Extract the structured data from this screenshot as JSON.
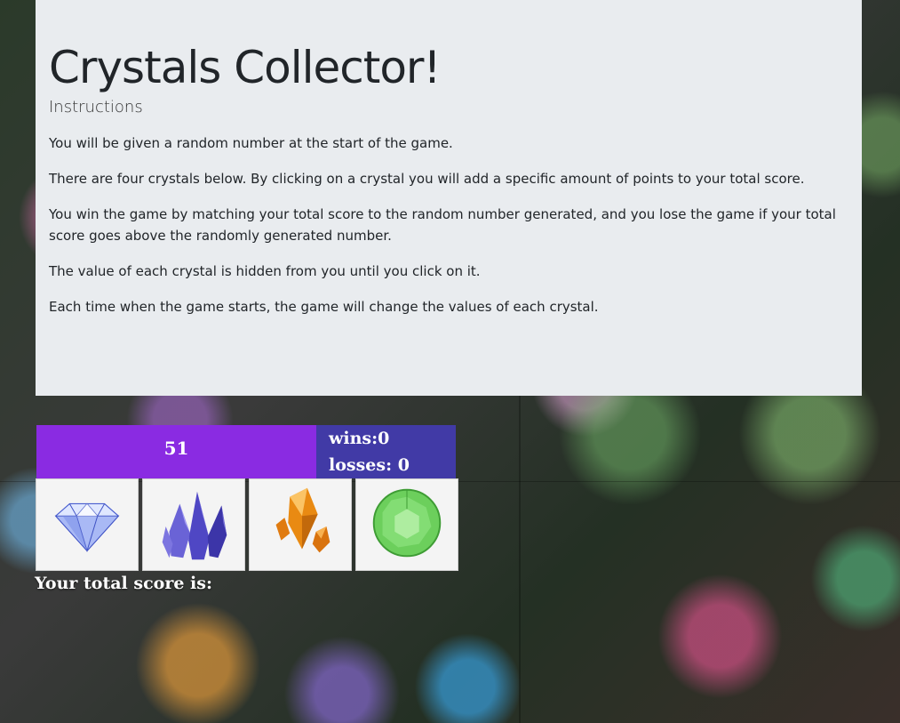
{
  "header": {
    "title": "Crystals Collector!",
    "subtitle": "Instructions"
  },
  "instructions": [
    "You will be given a random number at the start of the game.",
    "There are four crystals below. By clicking on a crystal you will add a specific amount of points to your total score.",
    "You win the game by matching your total score to the random number generated, and you lose the game if your total score goes above the randomly generated number.",
    "The value of each crystal is hidden from you until you click on it.",
    "Each time when the game starts, the game will change the values of each crystal."
  ],
  "game": {
    "target_number": "51",
    "wins_text": "wins:0",
    "losses_text": "losses: 0",
    "total_score_label": "Your total score is:"
  },
  "crystals": [
    {
      "icon": "diamond-crystal-icon"
    },
    {
      "icon": "purple-crystal-cluster-icon"
    },
    {
      "icon": "orange-crystal-icon"
    },
    {
      "icon": "green-gem-icon"
    }
  ],
  "colors": {
    "jumbotron_bg": "#e9ecef",
    "target_bg": "#8a2be2",
    "stats_bg": "#413aa6",
    "text_light": "#ffffff"
  }
}
